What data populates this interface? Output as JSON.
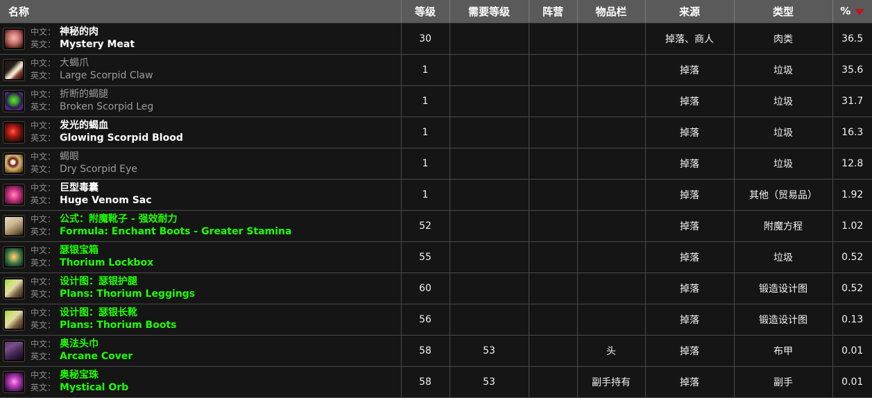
{
  "table": {
    "sort_column": "%",
    "sort_direction": "desc",
    "columns": [
      {
        "key": "name",
        "label": "名称",
        "align": "left"
      },
      {
        "key": "level",
        "label": "等级",
        "align": "center"
      },
      {
        "key": "req_level",
        "label": "需要等级",
        "align": "center"
      },
      {
        "key": "faction",
        "label": "阵营",
        "align": "center"
      },
      {
        "key": "slot",
        "label": "物品栏",
        "align": "center"
      },
      {
        "key": "source",
        "label": "来源",
        "align": "center"
      },
      {
        "key": "type",
        "label": "类型",
        "align": "center"
      },
      {
        "key": "pct",
        "label": "%",
        "align": "center"
      }
    ],
    "name_labels": {
      "zh": "中文：",
      "en": "英文："
    },
    "rows": [
      {
        "name_zh": "神秘的肉",
        "name_en": "Mystery Meat",
        "quality": "common",
        "icon": "mystery-meat-icon",
        "level": "30",
        "req_level": "",
        "faction": "",
        "slot": "",
        "source": "掉落、商人",
        "type": "肉类",
        "pct": "36.5"
      },
      {
        "name_zh": "大蝎爪",
        "name_en": "Large Scorpid Claw",
        "quality": "poor",
        "icon": "large-scorpid-claw-icon",
        "level": "1",
        "req_level": "",
        "faction": "",
        "slot": "",
        "source": "掉落",
        "type": "垃圾",
        "pct": "35.6"
      },
      {
        "name_zh": "折断的蝎腿",
        "name_en": "Broken Scorpid Leg",
        "quality": "poor",
        "icon": "broken-scorpid-leg-icon",
        "level": "1",
        "req_level": "",
        "faction": "",
        "slot": "",
        "source": "掉落",
        "type": "垃圾",
        "pct": "31.7"
      },
      {
        "name_zh": "发光的蝎血",
        "name_en": "Glowing Scorpid Blood",
        "quality": "common",
        "icon": "glowing-scorpid-blood-icon",
        "level": "1",
        "req_level": "",
        "faction": "",
        "slot": "",
        "source": "掉落",
        "type": "垃圾",
        "pct": "16.3"
      },
      {
        "name_zh": "蝎眼",
        "name_en": "Dry Scorpid Eye",
        "quality": "poor",
        "icon": "dry-scorpid-eye-icon",
        "level": "1",
        "req_level": "",
        "faction": "",
        "slot": "",
        "source": "掉落",
        "type": "垃圾",
        "pct": "12.8"
      },
      {
        "name_zh": "巨型毒囊",
        "name_en": "Huge Venom Sac",
        "quality": "common",
        "icon": "huge-venom-sac-icon",
        "level": "1",
        "req_level": "",
        "faction": "",
        "slot": "",
        "source": "掉落",
        "type": "其他（贸易品）",
        "pct": "1.92"
      },
      {
        "name_zh": "公式：附魔靴子 - 强效耐力",
        "name_en": "Formula: Enchant Boots - Greater Stamina",
        "quality": "uncommon",
        "icon": "formula-scroll-icon",
        "level": "52",
        "req_level": "",
        "faction": "",
        "slot": "",
        "source": "掉落",
        "type": "附魔方程",
        "pct": "1.02"
      },
      {
        "name_zh": "瑟银宝箱",
        "name_en": "Thorium Lockbox",
        "quality": "uncommon",
        "icon": "thorium-lockbox-icon",
        "level": "55",
        "req_level": "",
        "faction": "",
        "slot": "",
        "source": "掉落",
        "type": "垃圾",
        "pct": "0.52"
      },
      {
        "name_zh": "设计图：瑟银护腿",
        "name_en": "Plans: Thorium Leggings",
        "quality": "uncommon",
        "icon": "blacksmith-plans-icon",
        "level": "60",
        "req_level": "",
        "faction": "",
        "slot": "",
        "source": "掉落",
        "type": "锻造设计图",
        "pct": "0.52"
      },
      {
        "name_zh": "设计图：瑟银长靴",
        "name_en": "Plans: Thorium Boots",
        "quality": "uncommon",
        "icon": "blacksmith-plans-icon",
        "level": "56",
        "req_level": "",
        "faction": "",
        "slot": "",
        "source": "掉落",
        "type": "锻造设计图",
        "pct": "0.13"
      },
      {
        "name_zh": "奥法头巾",
        "name_en": "Arcane Cover",
        "quality": "uncommon",
        "icon": "arcane-cover-icon",
        "level": "58",
        "req_level": "53",
        "faction": "",
        "slot": "头",
        "source": "掉落",
        "type": "布甲",
        "pct": "0.01"
      },
      {
        "name_zh": "奥秘宝珠",
        "name_en": "Mystical Orb",
        "quality": "uncommon",
        "icon": "mystical-orb-icon",
        "level": "58",
        "req_level": "53",
        "faction": "",
        "slot": "副手持有",
        "source": "掉落",
        "type": "副手",
        "pct": "0.01"
      }
    ]
  },
  "colors": {
    "header_bg": "#5a5a5a",
    "row_bg": "#151515",
    "grid_line": "#4a4a4a",
    "quality_common": "#ffffff",
    "quality_poor": "#9d9d9d",
    "quality_uncommon": "#1eff00",
    "sort_caret": "#c1121f"
  },
  "icon_art": {
    "mystery-meat-icon": "radial-gradient(circle at 50% 45%, #f0b6b0 0%, #d98c86 28%, #b35f58 52%, #5a2a26 78%, #1a0c0a 100%)",
    "large-scorpid-claw-icon": "linear-gradient(135deg, #1a1410 0%, #2a2018 35%, #ddd0b0 52%, #f2ece0 60%, #8a3f28 74%, #140d0a 100%)",
    "broken-scorpid-leg-icon": "radial-gradient(circle at 50% 45%, #6ddc4a 0%, #3b9c2c 30%, #2a1a4a 58%, #5b2d8c 78%, #2a1240 100%)",
    "glowing-scorpid-blood-icon": "radial-gradient(circle at 45% 45%, #ff6a4a 0%, #d62a18 22%, #7a1410 52%, #3a0d0a 78%, #160505 100%)",
    "dry-scorpid-eye-icon": "radial-gradient(circle at 45% 42%, #ffffff 0%, #e8ded0 16%, #9a3524 22%, #6a2418 27%, #d6b878 48%, #8a6a2a 72%, #241a08 100%)",
    "huge-venom-sac-icon": "radial-gradient(circle at 50% 50%, #ff8ab8 0%, #e8539a 26%, #b02a72 52%, #6a1a48 78%, #240a18 100%)",
    "formula-scroll-icon": "linear-gradient(150deg, #e6d8bc 0%, #cbb894 40%, #a08a62 62%, #6a5a3c 82%, #241c12 100%)",
    "thorium-lockbox-icon": "radial-gradient(circle at 50% 48%, #e8d888 0%, #c0a850 24%, #3a7a4a 52%, #1e4a30 76%, #0a1a12 100%)",
    "blacksmith-plans-icon": "linear-gradient(135deg, #9ad83a 0%, #cfe27a 28%, #e2d9a8 46%, #7a6240 70%, #2a2012 100%)",
    "arcane-cover-icon": "linear-gradient(150deg, #5a3a6a 0%, #7a4e8c 30%, #4a2c5a 55%, #2a1638 78%, #100818 100%)",
    "mystical-orb-icon": "radial-gradient(circle at 52% 48%, #f0a8e8 0%, #d24ec8 26%, #8a2a92 54%, #4a1258 78%, #1a0620 100%)"
  }
}
